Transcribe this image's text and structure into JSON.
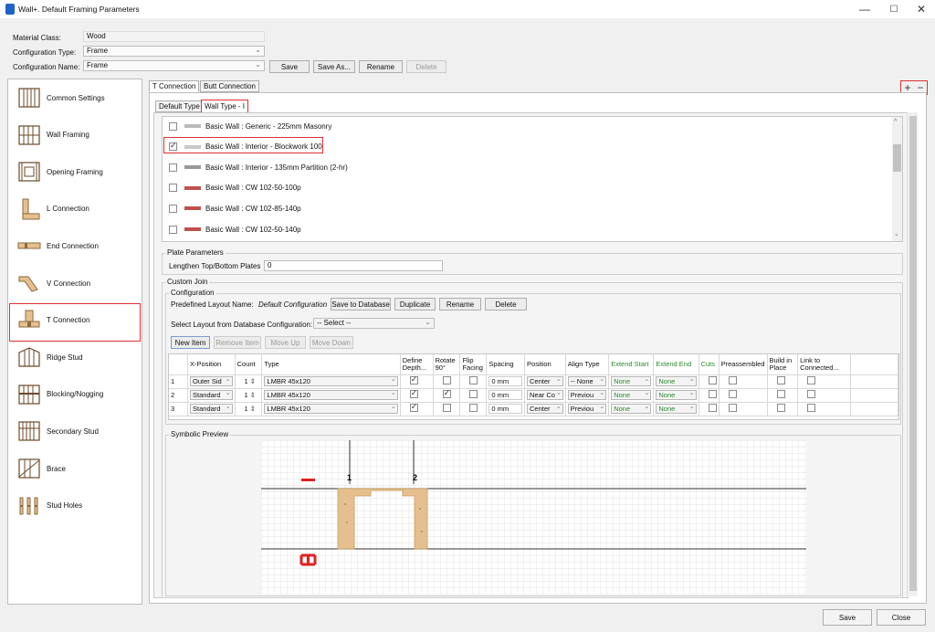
{
  "window": {
    "title": "Wall+. Default Framing Parameters",
    "controls": [
      "—",
      "☐",
      "✕"
    ]
  },
  "header": {
    "material_class": {
      "label": "Material Class:",
      "value": "Wood"
    },
    "configuration_type": {
      "label": "Configuration Type:",
      "value": "Frame"
    },
    "configuration_name": {
      "label": "Configuration Name:",
      "value": "Frame"
    },
    "buttons": {
      "save": "Save",
      "save_as": "Save As...",
      "rename": "Rename",
      "delete": "Delete"
    }
  },
  "sidebar": {
    "items": [
      {
        "label": "Common Settings",
        "icon": "studs-icon"
      },
      {
        "label": "Wall Framing",
        "icon": "wall-frame-icon"
      },
      {
        "label": "Opening Framing",
        "icon": "opening-frame-icon"
      },
      {
        "label": "L Connection",
        "icon": "l-connection-icon"
      },
      {
        "label": "End Connection",
        "icon": "end-connection-icon"
      },
      {
        "label": "V Connection",
        "icon": "v-connection-icon"
      },
      {
        "label": "T Connection",
        "icon": "t-connection-icon"
      },
      {
        "label": "Ridge Stud",
        "icon": "ridge-stud-icon"
      },
      {
        "label": "Blocking/Nogging",
        "icon": "blocking-icon"
      },
      {
        "label": "Secondary Stud",
        "icon": "secondary-stud-icon"
      },
      {
        "label": "Brace",
        "icon": "brace-icon"
      },
      {
        "label": "Stud Holes",
        "icon": "stud-holes-icon"
      }
    ]
  },
  "tabs": {
    "main": [
      "T Connection",
      "Butt Connection"
    ],
    "sub": [
      "Default Type",
      "Wall Type - I"
    ]
  },
  "wall_types": [
    {
      "label": "Basic Wall : Generic - 225mm Masonry",
      "checked": false,
      "color": "#bbbbbb"
    },
    {
      "label": "Basic Wall : Interior - Blockwork 100",
      "checked": true,
      "color": "#c8c8c8"
    },
    {
      "label": "Basic Wall : Interior - 135mm Partition (2-hr)",
      "checked": false,
      "color": "#999999"
    },
    {
      "label": "Basic Wall : CW 102-50-100p",
      "checked": false,
      "color": "#c0504d"
    },
    {
      "label": "Basic Wall : CW 102-85-140p",
      "checked": false,
      "color": "#c0504d"
    },
    {
      "label": "Basic Wall : CW 102-50-140p",
      "checked": false,
      "color": "#c0504d"
    }
  ],
  "plate_parameters": {
    "title": "Plate Parameters",
    "label": "Lengthen Top/Bottom Plates",
    "value": "0"
  },
  "custom_join": {
    "title": "Custom Join",
    "configuration_title": "Configuration",
    "predefined_label": "Predefined Layout Name:",
    "predefined_value": "Default Configuration",
    "buttons": {
      "save_db": "Save to Database",
      "duplicate": "Duplicate",
      "rename": "Rename",
      "delete": "Delete"
    },
    "select_layout_label": "Select Layout from Database Configuration:",
    "select_layout_value": "-- Select --",
    "item_buttons": {
      "new": "New Item",
      "remove": "Remove Item",
      "up": "Move Up",
      "down": "Move Down"
    }
  },
  "table": {
    "headers": [
      "",
      "X-Position",
      "Count",
      "Type",
      "Define Depth...",
      "Rotate 90°",
      "Flip Facing",
      "Spacing",
      "Position",
      "Align Type",
      "Extend Start",
      "Extend End",
      "Cuts",
      "Preassembled",
      "Build in Place",
      "Link to Connected..."
    ],
    "rows": [
      {
        "n": "1",
        "x": "Outer Sid",
        "count": "1",
        "type": "LMBR 45x120",
        "depth": true,
        "rotate": false,
        "flip": false,
        "spacing": "0 mm",
        "position": "Center",
        "align": "-- None",
        "ext_start": "None",
        "ext_end": "None"
      },
      {
        "n": "2",
        "x": "Standard",
        "count": "1",
        "type": "LMBR 45x120",
        "depth": true,
        "rotate": true,
        "flip": false,
        "spacing": "0 mm",
        "position": "Near Co",
        "align": "Previou",
        "ext_start": "None",
        "ext_end": "None"
      },
      {
        "n": "3",
        "x": "Standard",
        "count": "1",
        "type": "LMBR 45x120",
        "depth": true,
        "rotate": false,
        "flip": false,
        "spacing": "0 mm",
        "position": "Center",
        "align": "Previou",
        "ext_start": "None",
        "ext_end": "None"
      }
    ]
  },
  "preview": {
    "title": "Symbolic Preview",
    "markers": [
      "1",
      "2"
    ],
    "timber_color": "#e5c08e",
    "accent_color": "#e02020"
  },
  "footer": {
    "save": "Save",
    "close": "Close"
  },
  "toolbar": {
    "add": "+",
    "remove": "−"
  }
}
